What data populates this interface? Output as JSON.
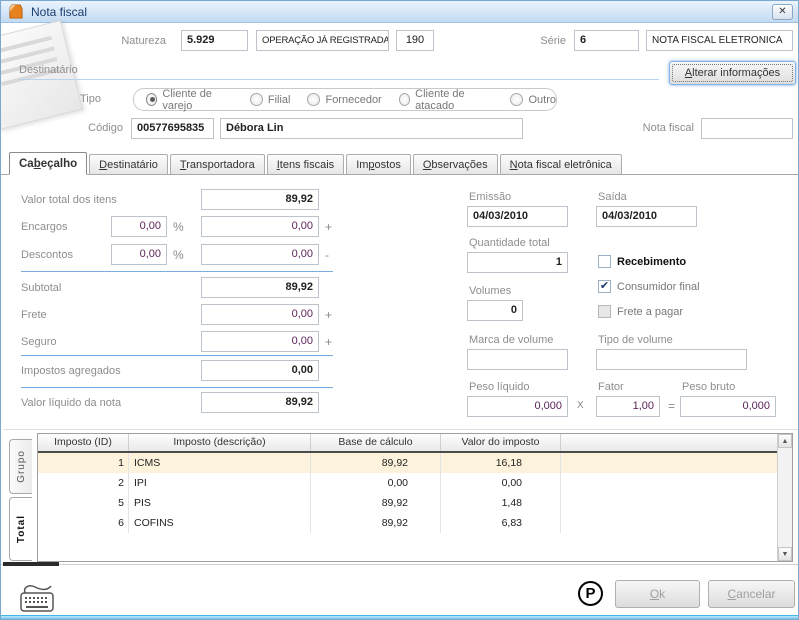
{
  "window": {
    "title": "Nota fiscal",
    "close_icon": "✕"
  },
  "colors": {
    "titlebar": "#c3daf1",
    "divider_blue": "#7aade0",
    "value_purple": "#5c2458",
    "highlight_row": "#fdf3dd",
    "footer_strip": "#6cc4ea",
    "doc_icon_orange": "#e8821e"
  },
  "header": {
    "natureza_label": "Natureza",
    "natureza_code": "5.929",
    "natureza_desc": "OPERAÇÃO JÁ REGISTRADA EM ECF",
    "natureza_num": "190",
    "serie_label": "Série",
    "serie_code": "6",
    "serie_desc": "NOTA FISCAL ELETRONICA"
  },
  "destinatario": {
    "section_label": "Destinatário",
    "alterar_button": {
      "pre": "",
      "key": "A",
      "post": "lterar informações"
    },
    "tipo_label": "Tipo",
    "tipo_selected": "Cliente de varejo",
    "tipo_options": [
      {
        "label": "Cliente de varejo",
        "selected": true
      },
      {
        "label": "Filial",
        "selected": false
      },
      {
        "label": "Fornecedor",
        "selected": false
      },
      {
        "label": "Cliente de atacado",
        "selected": false
      },
      {
        "label": "Outro",
        "selected": false
      }
    ],
    "codigo_label": "Código",
    "codigo_value": "00577695835",
    "nome_value": "Débora Lin",
    "nota_fiscal_label": "Nota fiscal",
    "nota_fiscal_value": ""
  },
  "tabs": [
    {
      "pre": "Ca",
      "key": "b",
      "post": "eçalho",
      "active": true
    },
    {
      "pre": "",
      "key": "D",
      "post": "estinatário",
      "active": false
    },
    {
      "pre": "",
      "key": "T",
      "post": "ransportadora",
      "active": false
    },
    {
      "pre": "",
      "key": "I",
      "post": "tens fiscais",
      "active": false
    },
    {
      "pre": "Im",
      "key": "p",
      "post": "ostos",
      "active": false
    },
    {
      "pre": "",
      "key": "O",
      "post": "bservações",
      "active": false
    },
    {
      "pre": "",
      "key": "N",
      "post": "ota fiscal eletrônica",
      "active": false
    }
  ],
  "cabecalho": {
    "left": {
      "valor_total": {
        "label": "Valor total dos itens",
        "value": "89,92"
      },
      "encargos": {
        "label": "Encargos",
        "pct": "0,00",
        "pct_sign": "%",
        "value": "0,00",
        "op": "+"
      },
      "descontos": {
        "label": "Descontos",
        "pct": "0,00",
        "pct_sign": "%",
        "value": "0,00",
        "op": "-"
      },
      "subtotal": {
        "label": "Subtotal",
        "value": "89,92"
      },
      "frete": {
        "label": "Frete",
        "value": "0,00",
        "op": "+"
      },
      "seguro": {
        "label": "Seguro",
        "value": "0,00",
        "op": "+"
      },
      "impostos_agregados": {
        "label": "Impostos agregados",
        "value": "0,00"
      },
      "valor_liquido": {
        "label": "Valor líquido da nota",
        "value": "89,92"
      }
    },
    "right": {
      "emissao": {
        "label": "Emissão",
        "value": "04/03/2010"
      },
      "saida": {
        "label": "Saída",
        "value": "04/03/2010"
      },
      "quantidade": {
        "label": "Quantidade total",
        "value": "1"
      },
      "volumes": {
        "label": "Volumes",
        "value": "0"
      },
      "marca_volume": {
        "label": "Marca de volume",
        "value": ""
      },
      "tipo_volume": {
        "label": "Tipo de volume",
        "value": ""
      },
      "peso_liquido": {
        "label": "Peso líquido",
        "value": "0,000"
      },
      "fator": {
        "label": "Fator",
        "value": "1,00"
      },
      "peso_bruto": {
        "label": "Peso bruto",
        "value": "0,000"
      },
      "mult_sign": "X",
      "eq_sign": "="
    },
    "checkboxes": [
      {
        "label": "Recebimento",
        "checked": false,
        "bold": true,
        "disabled": false
      },
      {
        "label": "Consumidor final",
        "checked": true,
        "bold": false,
        "disabled": false
      },
      {
        "label": "Frete a pagar",
        "checked": false,
        "bold": false,
        "disabled": true
      }
    ]
  },
  "taxes": {
    "group_tab": "Grupo",
    "total_tab": "Total",
    "columns": [
      "Imposto (ID)",
      "Imposto (descrição)",
      "Base de cálculo",
      "Valor do imposto"
    ],
    "rows": [
      {
        "id": "1",
        "name": "ICMS",
        "base": "89,92",
        "value": "16,18"
      },
      {
        "id": "2",
        "name": "IPI",
        "base": "0,00",
        "value": "0,00"
      },
      {
        "id": "5",
        "name": "PIS",
        "base": "89,92",
        "value": "1,48"
      },
      {
        "id": "6",
        "name": "COFINS",
        "base": "89,92",
        "value": "6,83"
      }
    ]
  },
  "icons": {
    "check": "✔",
    "scroll_up": "▲",
    "scroll_down": "▼"
  },
  "footer": {
    "p_badge": "P",
    "ok_button": {
      "pre": "",
      "key": "O",
      "post": "k"
    },
    "cancel_button": {
      "pre": "",
      "key": "C",
      "post": "ancelar"
    }
  }
}
